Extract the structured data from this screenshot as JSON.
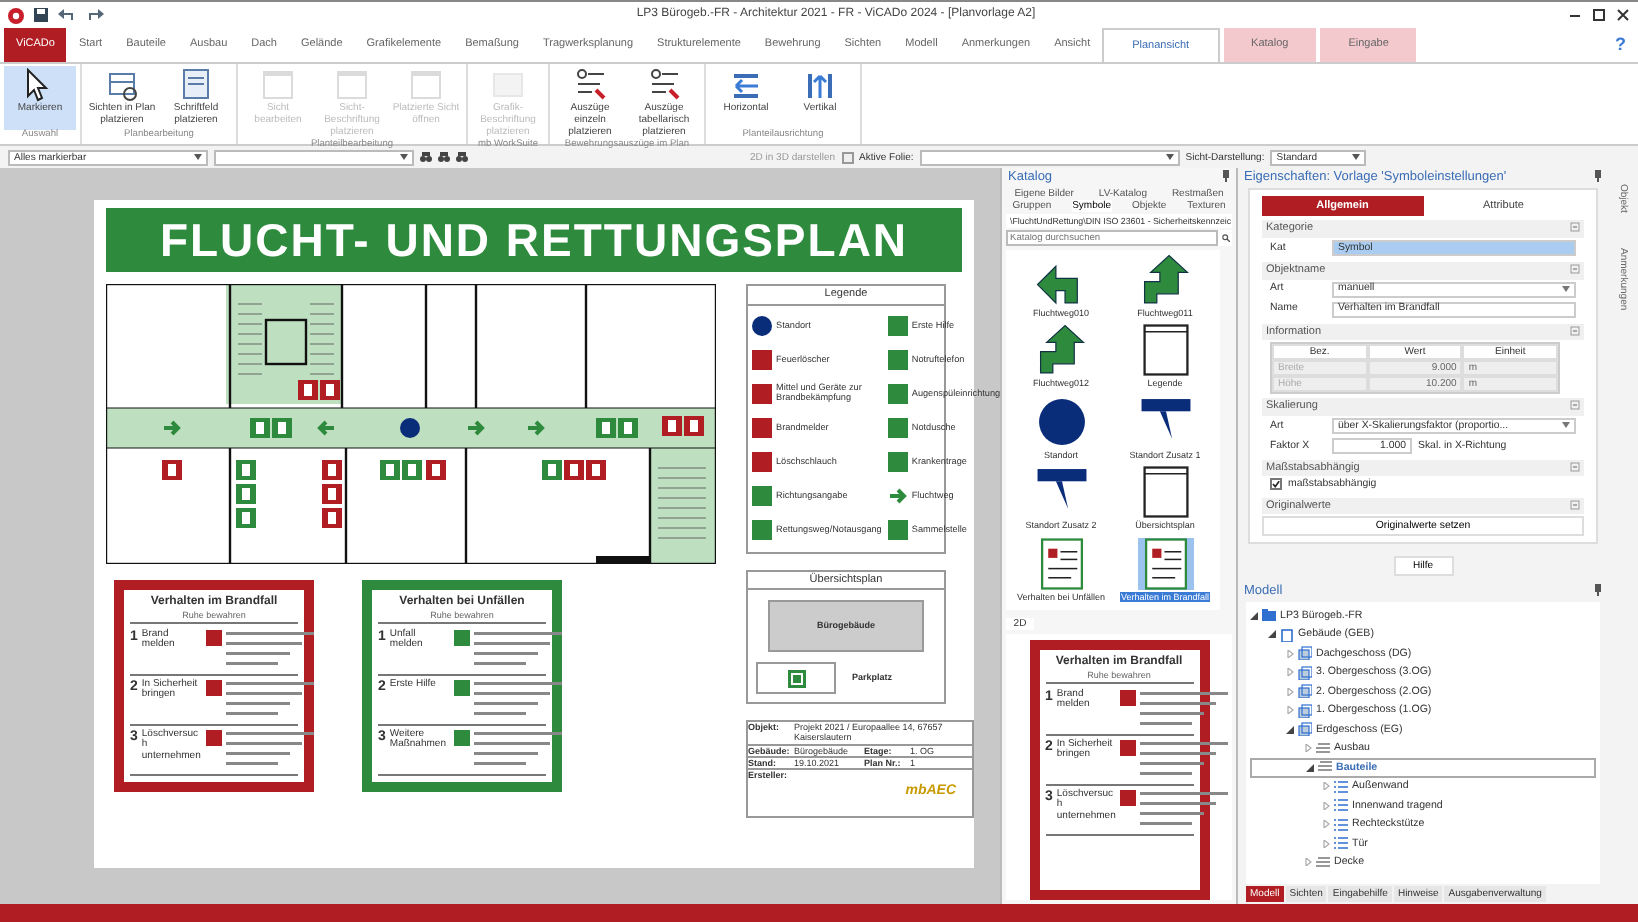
{
  "window": {
    "title": "LP3 Bürogeb.-FR - Architektur 2021 - FR - ViCADo 2024 - [Planvorlage A2]",
    "help": "?"
  },
  "tabs": [
    {
      "label": "ViCADo",
      "kind": "app",
      "selected": false
    },
    {
      "label": "Start",
      "kind": "normal",
      "selected": false
    },
    {
      "label": "Bauteile",
      "kind": "normal",
      "selected": false
    },
    {
      "label": "Ausbau",
      "kind": "normal",
      "selected": false
    },
    {
      "label": "Dach",
      "kind": "normal",
      "selected": false
    },
    {
      "label": "Gelände",
      "kind": "normal",
      "selected": false
    },
    {
      "label": "Grafikelemente",
      "kind": "normal",
      "selected": false
    },
    {
      "label": "Bemaßung",
      "kind": "normal",
      "selected": false
    },
    {
      "label": "Tragwerksplanung",
      "kind": "normal",
      "selected": false
    },
    {
      "label": "Strukturelemente",
      "kind": "normal",
      "selected": false
    },
    {
      "label": "Bewehrung",
      "kind": "normal",
      "selected": false
    },
    {
      "label": "Sichten",
      "kind": "normal",
      "selected": false
    },
    {
      "label": "Modell",
      "kind": "normal",
      "selected": false
    },
    {
      "label": "Anmerkungen",
      "kind": "normal",
      "selected": false
    },
    {
      "label": "Ansicht",
      "kind": "normal",
      "selected": false
    },
    {
      "label": "Planansicht",
      "kind": "normal",
      "selected": true
    },
    {
      "label": "Katalog",
      "kind": "context",
      "selected": false
    },
    {
      "label": "Eingabe",
      "kind": "context",
      "selected": false
    }
  ],
  "ribbon": [
    {
      "label": "Auswahl",
      "buttons": [
        {
          "label": "Markieren",
          "kind": "cursor",
          "disabled": false,
          "selected": true
        }
      ]
    },
    {
      "label": "Planbearbeitung",
      "buttons": [
        {
          "label": "Sichten in Plan platzieren",
          "kind": "frame",
          "disabled": false,
          "selected": false
        },
        {
          "label": "Schriftfeld platzieren",
          "kind": "document",
          "disabled": false,
          "selected": false
        }
      ]
    },
    {
      "label": "Planteilbearbeitung",
      "buttons": [
        {
          "label": "Sicht bearbeiten",
          "kind": "window",
          "disabled": true,
          "selected": false
        },
        {
          "label": "Sicht-Beschriftung platzieren",
          "kind": "window",
          "disabled": true,
          "selected": false
        },
        {
          "label": "Platzierte Sicht öffnen",
          "kind": "window",
          "disabled": true,
          "selected": false
        }
      ]
    },
    {
      "label": "mb WorkSuite",
      "buttons": [
        {
          "label": "Grafik-Beschriftung platzieren",
          "kind": "image",
          "disabled": true,
          "selected": false
        }
      ]
    },
    {
      "label": "Bewehrungsauszüge im Plan",
      "buttons": [
        {
          "label": "Auszüge einzeln platzieren",
          "kind": "list",
          "disabled": false,
          "selected": false
        },
        {
          "label": "Auszüge tabellarisch platzieren",
          "kind": "list",
          "disabled": false,
          "selected": false
        }
      ]
    },
    {
      "label": "Planteilausrichtung",
      "buttons": [
        {
          "label": "Horizontal",
          "kind": "horizontal",
          "disabled": false,
          "selected": false
        },
        {
          "label": "Vertikal",
          "kind": "vertical",
          "disabled": false,
          "selected": false
        }
      ]
    }
  ],
  "toolbar": {
    "filter": "Alles markierbar",
    "view_3d": "2D in 3D darstellen",
    "layer_label": "Aktive Folie:",
    "display_label": "Sicht-Darstellung:",
    "display_value": "Standard"
  },
  "plan": {
    "title": "FLUCHT- UND RETTUNGSPLAN",
    "legend": {
      "title": "Legende",
      "items": [
        {
          "label": "Standort",
          "kind": "dot",
          "color": "#0a2d7a"
        },
        {
          "label": "Erste Hilfe",
          "kind": "sign",
          "color": "#2e8b3e"
        },
        {
          "label": "Feuerlöscher",
          "kind": "sign",
          "color": "#b01e23"
        },
        {
          "label": "Notruftelefon",
          "kind": "sign",
          "color": "#2e8b3e"
        },
        {
          "label": "Mittel und Geräte zur Brandbekämpfung",
          "kind": "sign",
          "color": "#b01e23"
        },
        {
          "label": "Augenspüleinrichtung",
          "kind": "sign",
          "color": "#2e8b3e"
        },
        {
          "label": "Brandmelder",
          "kind": "sign",
          "color": "#b01e23"
        },
        {
          "label": "Notdusche",
          "kind": "sign",
          "color": "#2e8b3e"
        },
        {
          "label": "Löschschlauch",
          "kind": "sign",
          "color": "#b01e23"
        },
        {
          "label": "Krankentrage",
          "kind": "sign",
          "color": "#2e8b3e"
        },
        {
          "label": "Richtungsangabe",
          "kind": "sign",
          "color": "#2e8b3e"
        },
        {
          "label": "Fluchtweg",
          "kind": "arrow",
          "color": "#2e8b3e"
        },
        {
          "label": "Rettungsweg/Notausgang",
          "kind": "sign",
          "color": "#2e8b3e"
        },
        {
          "label": "Sammelstelle",
          "kind": "sign",
          "color": "#2e8b3e"
        }
      ]
    },
    "overview": {
      "title": "Übersichtsplan",
      "building": "Bürogebäude",
      "parking": "Parkplatz"
    },
    "title_block": {
      "rows": [
        {
          "label": "Objekt:",
          "value": "Projekt 2021 / Europaallee 14, 67657 Kaiserslautern"
        },
        {
          "label": "Gebäude:",
          "value": "Bürogebäude",
          "label2": "Etage:",
          "value2": "1. OG"
        },
        {
          "label": "Stand:",
          "value": "19.10.2021",
          "label2": "Plan Nr.:",
          "value2": "1"
        }
      ],
      "author": "Ersteller:",
      "logo": "mbAEC"
    },
    "cards": [
      {
        "title": "Verhalten im Brandfall",
        "subtitle": "Ruhe bewahren",
        "color": "#b01e23",
        "steps": [
          {
            "num": "1",
            "label": "Brand melden"
          },
          {
            "num": "2",
            "label": "In Sicherheit bringen"
          },
          {
            "num": "3",
            "label": "Löschversuch unternehmen"
          }
        ]
      },
      {
        "title": "Verhalten bei Unfällen",
        "subtitle": "Ruhe bewahren",
        "color": "#2e8b3e",
        "steps": [
          {
            "num": "1",
            "label": "Unfall melden"
          },
          {
            "num": "2",
            "label": "Erste Hilfe"
          },
          {
            "num": "3",
            "label": "Weitere Maßnahmen"
          }
        ]
      }
    ]
  },
  "catalog": {
    "title": "Katalog",
    "tabs_top": [
      {
        "label": "Eigene Bilder",
        "selected": false
      },
      {
        "label": "LV-Katalog",
        "selected": false
      },
      {
        "label": "Restmaßen",
        "selected": false
      }
    ],
    "tabs": [
      {
        "label": "Gruppen",
        "selected": false
      },
      {
        "label": "Symbole",
        "selected": true
      },
      {
        "label": "Objekte",
        "selected": false
      },
      {
        "label": "Texturen",
        "selected": false
      }
    ],
    "path": "\\FluchtUndRettung\\DIN ISO 23601 - Sicherheitskennzeic",
    "search": {
      "placeholder": "Katalog durchsuchen"
    },
    "items": [
      {
        "label": "Fluchtweg010",
        "kind": "arrow-left",
        "selected": false
      },
      {
        "label": "Fluchtweg011",
        "kind": "arrow-up",
        "selected": false
      },
      {
        "label": "Fluchtweg012",
        "kind": "arrow-up",
        "selected": false
      },
      {
        "label": "Legende",
        "kind": "frame",
        "selected": false
      },
      {
        "label": "Standort",
        "kind": "dot",
        "selected": false
      },
      {
        "label": "Standort Zusatz 1",
        "kind": "pin",
        "selected": false
      },
      {
        "label": "Standort Zusatz 2",
        "kind": "pin",
        "selected": false
      },
      {
        "label": "Übersichtsplan",
        "kind": "frame",
        "selected": false
      },
      {
        "label": "Verhalten bei Unfällen",
        "kind": "sheet",
        "selected": false
      },
      {
        "label": "Verhalten im Brandfall",
        "kind": "sheet",
        "selected": true
      }
    ],
    "preview_tab": "2D",
    "preview": {
      "title": "Verhalten im Brandfall",
      "subtitle": "Ruhe bewahren",
      "color": "#b01e23",
      "steps": [
        {
          "num": "1",
          "label": "Brand melden"
        },
        {
          "num": "2",
          "label": "In Sicherheit bringen"
        },
        {
          "num": "3",
          "label": "Löschversuch unternehmen"
        }
      ]
    }
  },
  "properties": {
    "title": "Eigenschaften: Vorlage 'Symboleinstellungen'",
    "tabs": [
      {
        "label": "Allgemein",
        "selected": true
      },
      {
        "label": "Attribute",
        "selected": false
      }
    ],
    "kategorie": {
      "title": "Kategorie",
      "label": "Kat",
      "value": "Symbol"
    },
    "objektname": {
      "title": "Objektname",
      "art_label": "Art",
      "art": "manuell",
      "name_label": "Name",
      "name": "Verhalten im Brandfall"
    },
    "information": {
      "title": "Information",
      "columns": [
        "Bez.",
        "Wert",
        "Einheit"
      ],
      "rows": [
        [
          "Breite",
          "9.000",
          "m"
        ],
        [
          "Höhe",
          "10.200",
          "m"
        ]
      ]
    },
    "skalierung": {
      "title": "Skalierung",
      "art_label": "Art",
      "art": "über X-Skalierungsfaktor (proportio...",
      "faktor_label": "Faktor X",
      "faktor": "1.000",
      "note": "Skal. in X-Richtung"
    },
    "massstab": {
      "title": "Maßstabsabhängig",
      "label": "maßstabsabhängig",
      "checked": true
    },
    "original": {
      "title": "Originalwerte",
      "button": "Originalwerte setzen"
    },
    "help": "Hilfe"
  },
  "model": {
    "title": "Modell",
    "tree": [
      {
        "label": "LP3 Bürogeb.-FR",
        "kind": "folder",
        "selected": false,
        "expanded": true,
        "children": [
          {
            "label": "Gebäude (GEB)",
            "kind": "building",
            "selected": false,
            "expanded": true,
            "children": [
              {
                "label": "Dachgeschoss (DG)",
                "kind": "floor",
                "selected": false,
                "expanded": false
              },
              {
                "label": "3. Obergeschoss (3.OG)",
                "kind": "floor",
                "selected": false,
                "expanded": false
              },
              {
                "label": "2. Obergeschoss (2.OG)",
                "kind": "floor",
                "selected": false,
                "expanded": false
              },
              {
                "label": "1. Obergeschoss (1.OG)",
                "kind": "floor",
                "selected": false,
                "expanded": false
              },
              {
                "label": "Erdgeschoss (EG)",
                "kind": "floor",
                "selected": false,
                "expanded": true,
                "children": [
                  {
                    "label": "Ausbau",
                    "kind": "layer",
                    "selected": false,
                    "expanded": false
                  },
                  {
                    "label": "Bauteile",
                    "kind": "layer",
                    "selected": true,
                    "expanded": true,
                    "children": [
                      {
                        "label": "Außenwand",
                        "kind": "list",
                        "selected": false,
                        "expanded": false
                      },
                      {
                        "label": "Innenwand tragend",
                        "kind": "list",
                        "selected": false,
                        "expanded": false
                      },
                      {
                        "label": "Rechteckstütze",
                        "kind": "list",
                        "selected": false,
                        "expanded": false
                      },
                      {
                        "label": "Tür",
                        "kind": "list",
                        "selected": false,
                        "expanded": false
                      }
                    ]
                  },
                  {
                    "label": "Decke",
                    "kind": "layer",
                    "selected": false,
                    "expanded": false
                  }
                ]
              }
            ]
          }
        ]
      }
    ],
    "tabs": [
      {
        "label": "Modell",
        "selected": true
      },
      {
        "label": "Sichten",
        "selected": false
      },
      {
        "label": "Eingabehilfe",
        "selected": false
      },
      {
        "label": "Hinweise",
        "selected": false
      },
      {
        "label": "Ausgabenverwaltung",
        "selected": false
      }
    ]
  },
  "side_tabs": [
    "Objekt",
    "Anmerkungen"
  ]
}
